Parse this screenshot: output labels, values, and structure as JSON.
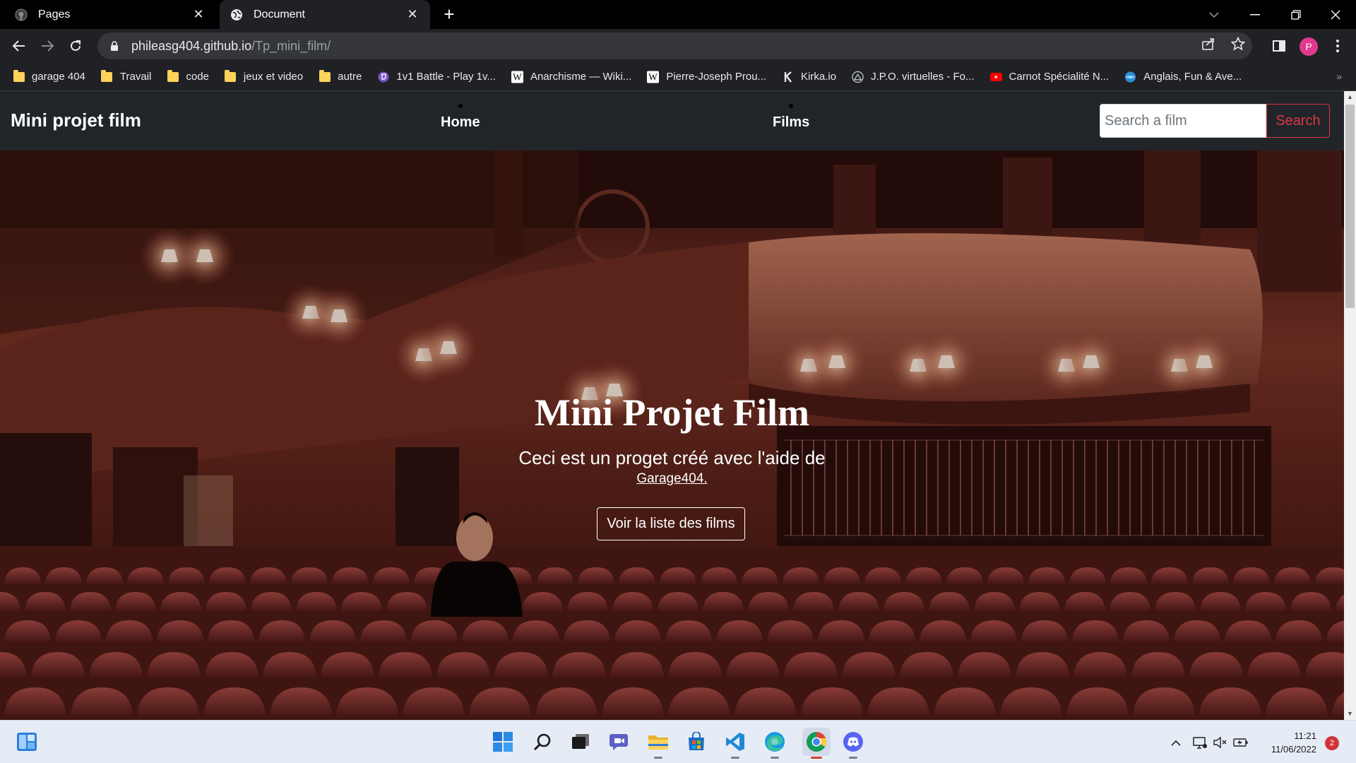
{
  "browser": {
    "tabs": [
      {
        "title": "Pages",
        "active": false
      },
      {
        "title": "Document",
        "active": true
      }
    ],
    "url_host": "phileasg404.github.io",
    "url_path": "/Tp_mini_film/",
    "profile_initial": "P",
    "bookmarks": [
      {
        "label": "garage 404",
        "icon": "folder-icon"
      },
      {
        "label": "Travail",
        "icon": "folder-icon"
      },
      {
        "label": "code",
        "icon": "folder-icon"
      },
      {
        "label": "jeux et video",
        "icon": "folder-icon"
      },
      {
        "label": "autre",
        "icon": "folder-icon"
      },
      {
        "label": "1v1 Battle - Play 1v...",
        "icon": "twitch-icon"
      },
      {
        "label": "Anarchisme — Wiki...",
        "icon": "wikipedia-icon"
      },
      {
        "label": "Pierre-Joseph Prou...",
        "icon": "wikipedia-icon"
      },
      {
        "label": "Kirka.io",
        "icon": "kirka-icon"
      },
      {
        "label": "J.P.O. virtuelles - Fo...",
        "icon": "jpo-icon"
      },
      {
        "label": "Carnot Spécialité N...",
        "icon": "youtube-icon"
      },
      {
        "label": "Anglais, Fun & Ave...",
        "icon": "globe-icon"
      }
    ]
  },
  "site": {
    "brand": "Mini projet film",
    "nav": [
      {
        "label": "Home"
      },
      {
        "label": "Films"
      }
    ],
    "search_placeholder": "Search a film",
    "search_button": "Search",
    "hero": {
      "title": "Mini Projet Film",
      "subtitle": "Ceci est un proget créé avec l'aide de",
      "link_text": "Garage404.",
      "button": "Voir la liste des films"
    }
  },
  "taskbar": {
    "time": "11:21",
    "date": "11/06/2022",
    "notification_count": "2"
  },
  "colors": {
    "navbar_bg": "#212529",
    "search_button": "#dc3545",
    "hero_tint": "#8a3a2c",
    "profile": "#e0398d"
  }
}
